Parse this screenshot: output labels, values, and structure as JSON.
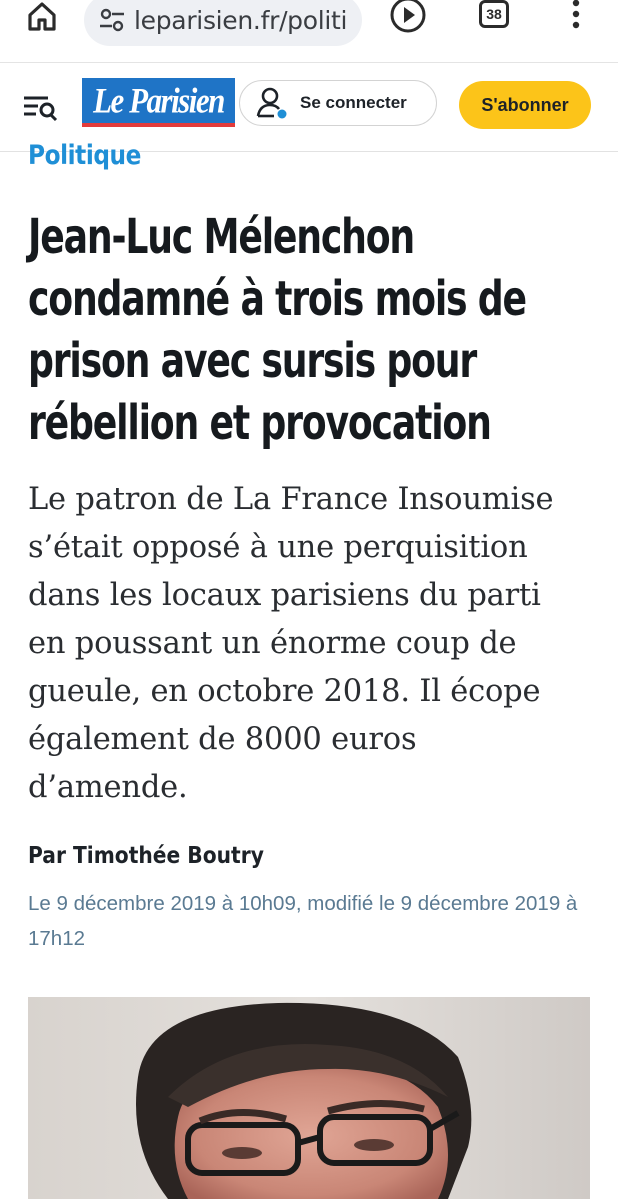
{
  "browser": {
    "url": "leparisien.fr/politi",
    "tab_count": "38",
    "home_icon": "home-icon",
    "tune_icon": "site-settings-icon",
    "play_icon": "play-icon",
    "more_icon": "more-vert-icon"
  },
  "header": {
    "logo_text": "Le Parisien",
    "menu_icon": "menu-search-icon",
    "connect_label": "Se connecter",
    "subscribe_label": "S'abonner",
    "colors": {
      "logo_blue": "#1f74c6",
      "subscribe_yellow": "#fcc419",
      "rubric_blue": "#1f8fd6"
    }
  },
  "article": {
    "rubric": "Politique",
    "headline_lines": [
      "Jean-Luc Mélenchon",
      "condamné à trois mois de",
      "prison avec sursis pour",
      "rébellion et provocation"
    ],
    "lead_lines": [
      "Le patron de La France Insoumise",
      "s’était opposé à une perquisition",
      "dans les locaux parisiens du parti",
      "en poussant un énorme coup de",
      "gueule, en octobre 2018. Il écope",
      "également de 8000 euros",
      "d’amende."
    ],
    "author": "Par Timothée Boutry",
    "dates_lines": [
      "Le 9 décembre 2019 à 10h09, modifié le 9 décembre 2019 à",
      "17h12"
    ]
  }
}
